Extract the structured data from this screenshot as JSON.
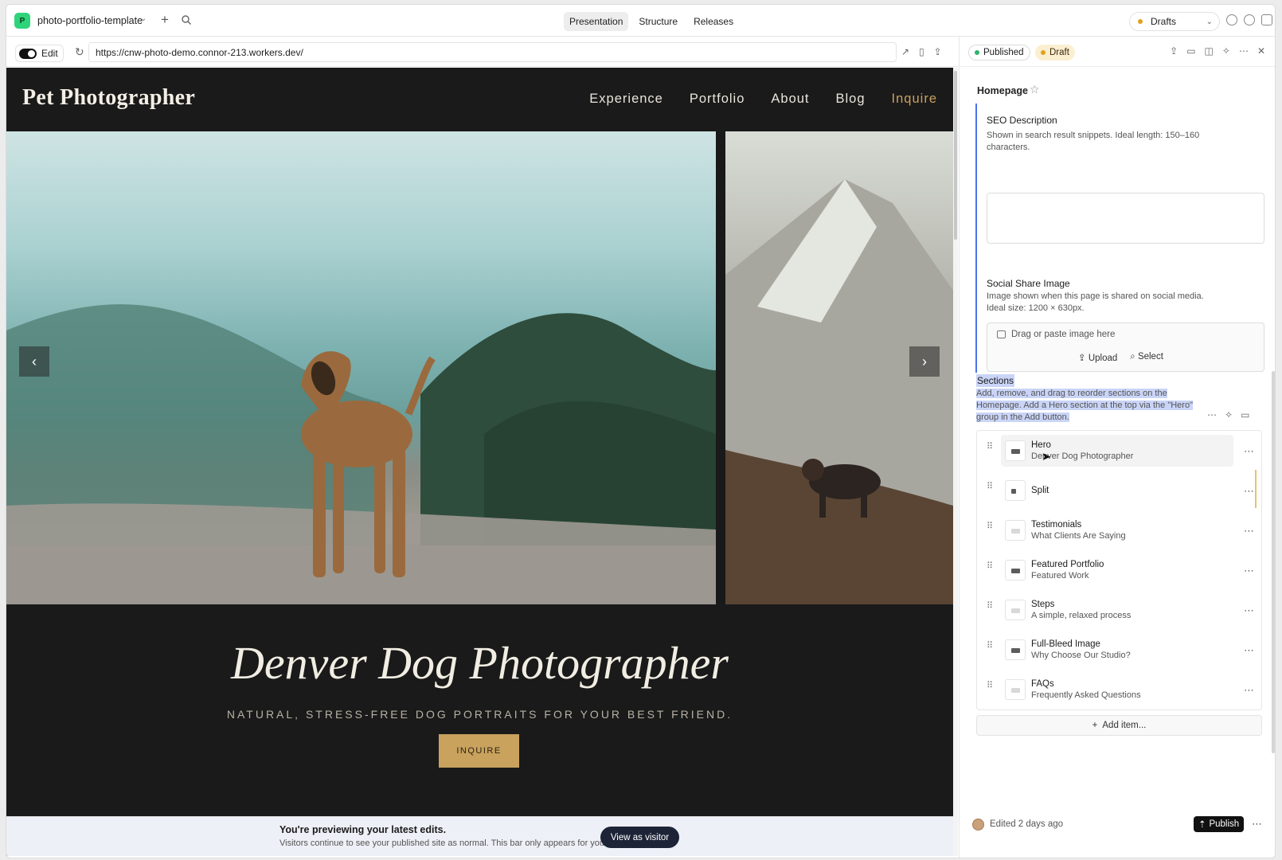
{
  "app": {
    "logo_letter": "P",
    "project_name": "photo-portfolio-template",
    "tabs": [
      {
        "label": "Presentation"
      },
      {
        "label": "Structure"
      },
      {
        "label": "Releases"
      }
    ],
    "drafts_label": "Drafts"
  },
  "toolbar": {
    "edit_label": "Edit",
    "url": "https://cnw-photo-demo.connor-213.workers.dev/"
  },
  "site": {
    "title": "Pet Photographer",
    "nav": [
      "Experience",
      "Portfolio",
      "About",
      "Blog",
      "Inquire"
    ],
    "hero_heading": "Denver Dog Photographer",
    "hero_subtitle": "NATURAL, STRESS-FREE DOG PORTRAITS FOR YOUR BEST FRIEND.",
    "hero_button": "INQUIRE",
    "prev_arrow": "‹",
    "next_arrow": "›"
  },
  "preview_bar": {
    "title": "You're previewing your latest edits.",
    "subtitle": "Visitors continue to see your published site as normal. This bar only appears for you.",
    "button": "View as visitor"
  },
  "panel": {
    "status_published": "Published",
    "status_draft": "Draft",
    "page_name": "Homepage",
    "seo": {
      "title": "SEO Description",
      "description": "Shown in search result snippets. Ideal length: 150–160 characters.",
      "value": ""
    },
    "social": {
      "title": "Social Share Image",
      "description": "Image shown when this page is shared on social media. Ideal size: 1200 × 630px.",
      "drop_text": "Drag or paste image here",
      "upload_label": "Upload",
      "select_label": "Select"
    },
    "sections": {
      "title": "Sections",
      "description": "Add, remove, and drag to reorder sections on the Homepage. Add a Hero section at the top via the \"Hero\" group in the Add button.",
      "items": [
        {
          "name": "Hero",
          "subtitle": "Denver Dog Photographer"
        },
        {
          "name": "Split",
          "subtitle": ""
        },
        {
          "name": "Testimonials",
          "subtitle": "What Clients Are Saying"
        },
        {
          "name": "Featured Portfolio",
          "subtitle": "Featured Work"
        },
        {
          "name": "Steps",
          "subtitle": "A simple, relaxed process"
        },
        {
          "name": "Full-Bleed Image",
          "subtitle": "Why Choose Our Studio?"
        },
        {
          "name": "FAQs",
          "subtitle": "Frequently Asked Questions"
        }
      ],
      "add_label": "Add item..."
    },
    "footer": {
      "edited": "Edited 2 days ago",
      "publish_label": "Publish"
    }
  },
  "colors": {
    "accent_gold": "#c9a25e",
    "published_dot": "#2eb36b",
    "draft_dot": "#e0a21b",
    "selection_blue": "#4a73e8"
  }
}
